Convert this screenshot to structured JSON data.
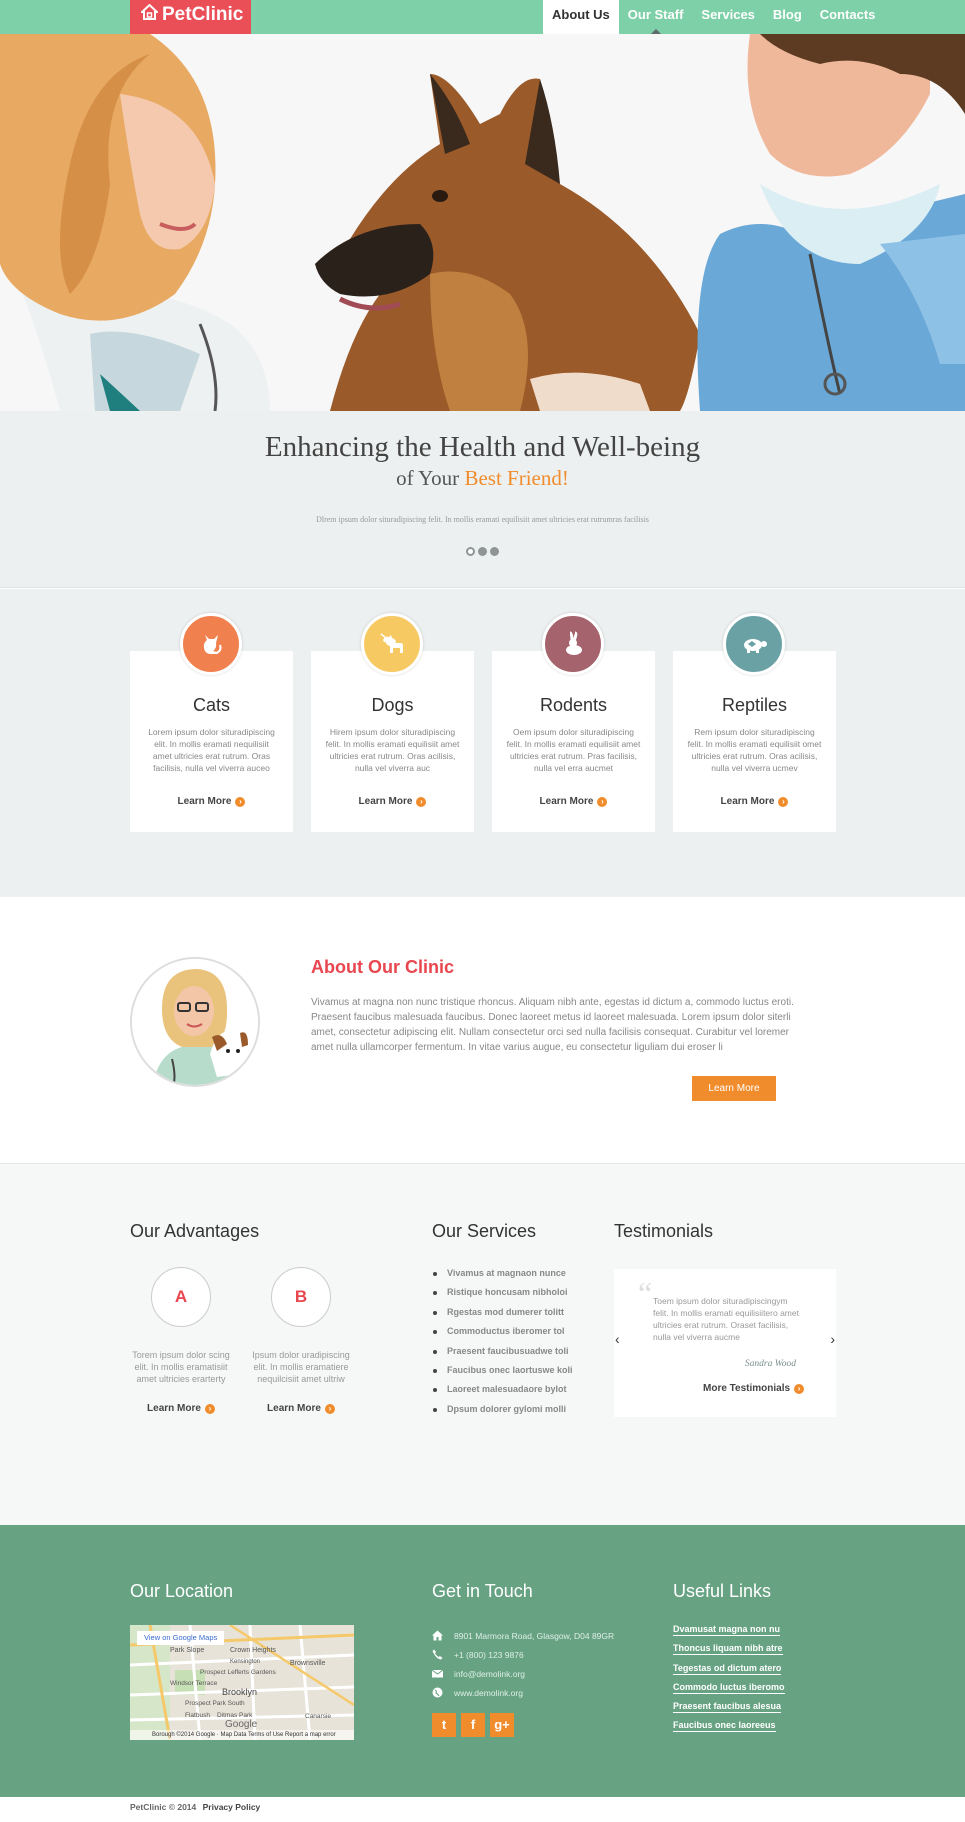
{
  "brand": {
    "name": "PetClinic",
    "logo_color": "#ea4e57",
    "icon": "house-icon"
  },
  "nav": {
    "items": [
      {
        "label": "About Us",
        "active": true
      },
      {
        "label": "Our Staff",
        "active": false
      },
      {
        "label": "Services",
        "active": false
      },
      {
        "label": "Blog",
        "active": false
      },
      {
        "label": "Contacts",
        "active": false
      }
    ]
  },
  "slider": {
    "title": "Enhancing the Health and Well-being",
    "subtitle_prefix": "of Your",
    "subtitle_highlight": "Best Friend!",
    "text": "Dlrem ipsum dolor situradipiscing felit. In mollis eramati equilisiit amet ultricies erat rutrumras facilisis",
    "slide_count": 3,
    "active_slide": 1
  },
  "animals": [
    {
      "title": "Cats",
      "text": "Lorem ipsum dolor situradipiscing elit. In mollis eramati nequilisiit amet ultricies erat rutrum. Oras facilisis, nulla vel viverra auceo",
      "link": "Learn More",
      "icon": "cat-icon",
      "color": "#f0814f"
    },
    {
      "title": "Dogs",
      "text": "Hirem ipsum dolor situradipiscing felit. In mollis eramati equilisiit amet ultricies erat rutrum. Oras acilisis, nulla vel viverra auc",
      "link": "Learn More",
      "icon": "dog-icon",
      "color": "#f6c963"
    },
    {
      "title": "Rodents",
      "text": "Oem ipsum dolor situradipiscing felit. In mollis eramati equilisiit amet ultricies erat rutrum. Pras facilisis, nulla vel erra aucmet",
      "link": "Learn More",
      "icon": "rabbit-icon",
      "color": "#a5646d"
    },
    {
      "title": "Reptiles",
      "text": "Rem ipsum dolor situradipiscing felit. In mollis eramati equilisiit omet ultricies erat rutrum. Oras acilisis, nulla vel viverra ucmev",
      "link": "Learn More",
      "icon": "turtle-icon",
      "color": "#6aa1a5"
    }
  ],
  "about": {
    "title": "About Our Clinic",
    "text": "Vivamus at magna non nunc tristique rhoncus. Aliquam nibh ante, egestas id dictum a, commodo luctus eroti. Praesent faucibus malesuada faucibus. Donec laoreet metus id laoreet malesuada. Lorem ipsum dolor siterli amet, consectetur adipiscing elit. Nullam consectetur orci sed nulla facilisis consequat. Curabitur vel loremer amet nulla ullamcorper fermentum. In vitae varius augue, eu consectetur liguliam dui eroser li",
    "button": "Learn More"
  },
  "advantages": {
    "title": "Our Advantages",
    "items": [
      {
        "letter": "A",
        "text": "Torem ipsum dolor scing elit. In mollis eramatisiit amet ultricies erarterty",
        "link": "Learn More"
      },
      {
        "letter": "B",
        "text": "Ipsum dolor uradipiscing elit. In mollis eramatiere nequilcisiit amet ultriw",
        "link": "Learn More"
      }
    ]
  },
  "services": {
    "title": "Our Services",
    "items": [
      "Vivamus at magnaon nunce",
      "Ristique honcusam nibholoi",
      "Rgestas mod dumerer tolitt",
      "Commoductus iberomer tol",
      "Praesent faucibusuadwe toli",
      "Faucibus onec laortuswe koli",
      "Laoreet malesuadaore bylot",
      "Dpsum dolorer gylomi molli"
    ]
  },
  "testimonials": {
    "title": "Testimonials",
    "quote": "Toem ipsum dolor situradipiscingym felit. In mollis eramati equilisiitero amet ultricies erat rutrum. Oraset facilisis, nulla vel viverra aucme",
    "author": "Sandra Wood",
    "more": "More Testimonials"
  },
  "footer": {
    "location_title": "Our Location",
    "map_button": "View on Google Maps",
    "map_footer": "Borough ©2014 Google · Map Data    Terms of Use    Report a map error",
    "map_labels": [
      "Park Slope",
      "Crown Heights",
      "Brownsville",
      "Prospect Lefferts Gardens",
      "Windsor Terrace",
      "Brooklyn",
      "Prospect Park South",
      "Flatbush",
      "Ditmas Park",
      "Canarsie",
      "Kensington",
      "Google"
    ],
    "contact_title": "Get in Touch",
    "contacts": [
      {
        "icon": "home-icon",
        "text": "8901 Marmora Road, Glasgow, D04 89GR"
      },
      {
        "icon": "phone-icon",
        "text": "+1 (800) 123 9876"
      },
      {
        "icon": "mail-icon",
        "text": "info@demolink.org"
      },
      {
        "icon": "globe-icon",
        "text": "www.demolink.org"
      }
    ],
    "social": [
      {
        "icon": "twitter-icon",
        "glyph": "t"
      },
      {
        "icon": "facebook-icon",
        "glyph": "f"
      },
      {
        "icon": "google-plus-icon",
        "glyph": "g+"
      }
    ],
    "links_title": "Useful Links",
    "links": [
      "Dvamusat magna non nu",
      "Thoncus liquam nibh atre",
      "Tegestas od dictum atero",
      "Commodo luctus iberomo",
      "Praesent faucibus alesua",
      "Faucibus onec laoreeus"
    ]
  },
  "copyright": {
    "text": "PetClinic © 2014",
    "link": "Privacy Policy"
  },
  "colors": {
    "header": "#7dd0a7",
    "accent": "#f08c2c",
    "brand_red": "#ea4e57",
    "footer": "#67a383"
  }
}
